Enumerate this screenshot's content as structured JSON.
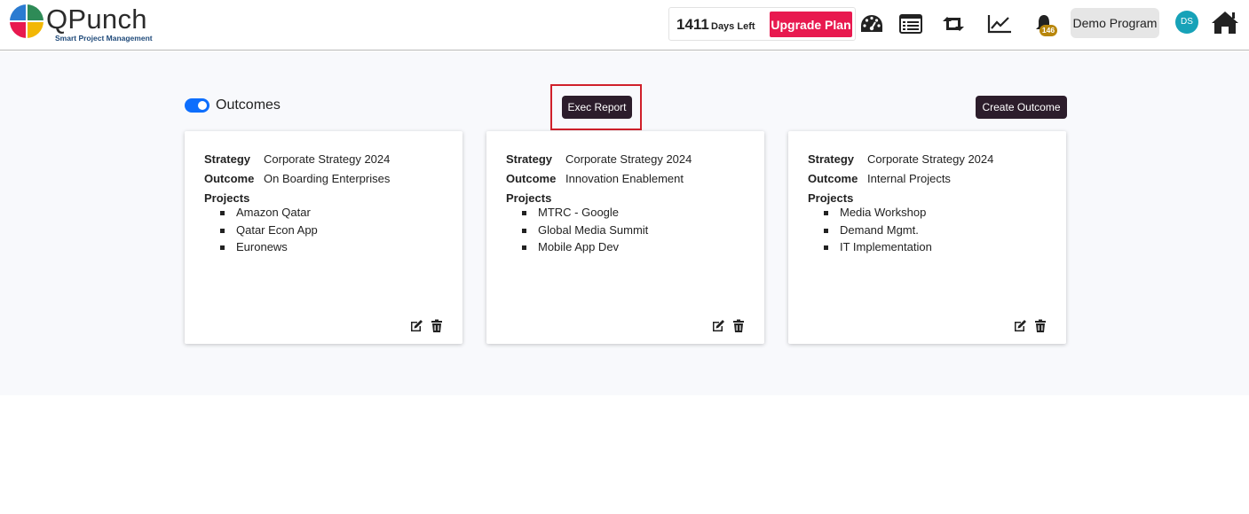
{
  "header": {
    "logo_text": "QPunch",
    "logo_tagline": "Smart Project Management",
    "days_left_number": "1411",
    "days_left_label": "Days Left",
    "upgrade_label": "Upgrade Plan",
    "icons": [
      "dashboard-icon",
      "list-icon",
      "retweet-icon",
      "chart-line-icon",
      "bell-icon",
      "home-icon"
    ],
    "notification_count": "146",
    "program_label": "Demo Program",
    "avatar_initials": "DS"
  },
  "toolbar": {
    "toggle_label": "Outcomes",
    "exec_report_label": "Exec Report",
    "create_outcome_label": "Create Outcome"
  },
  "labels": {
    "strategy": "Strategy",
    "outcome": "Outcome",
    "projects": "Projects"
  },
  "cards": [
    {
      "strategy": "Corporate Strategy 2024",
      "outcome": "On Boarding Enterprises",
      "projects": [
        "Amazon Qatar",
        "Qatar Econ App",
        "Euronews"
      ]
    },
    {
      "strategy": "Corporate Strategy 2024",
      "outcome": "Innovation Enablement",
      "projects": [
        "MTRC - Google",
        "Global Media Summit",
        "Mobile App Dev"
      ]
    },
    {
      "strategy": "Corporate Strategy 2024",
      "outcome": "Internal Projects",
      "projects": [
        "Media Workshop",
        "Demand Mgmt.",
        "IT Implementation"
      ]
    }
  ],
  "colors": {
    "accent_dark": "#2c1d2b",
    "upgrade": "#e8194f",
    "toggle": "#0d6efd",
    "highlight": "#d0202a",
    "avatar": "#17a2b8",
    "badge": "#b8860b"
  }
}
